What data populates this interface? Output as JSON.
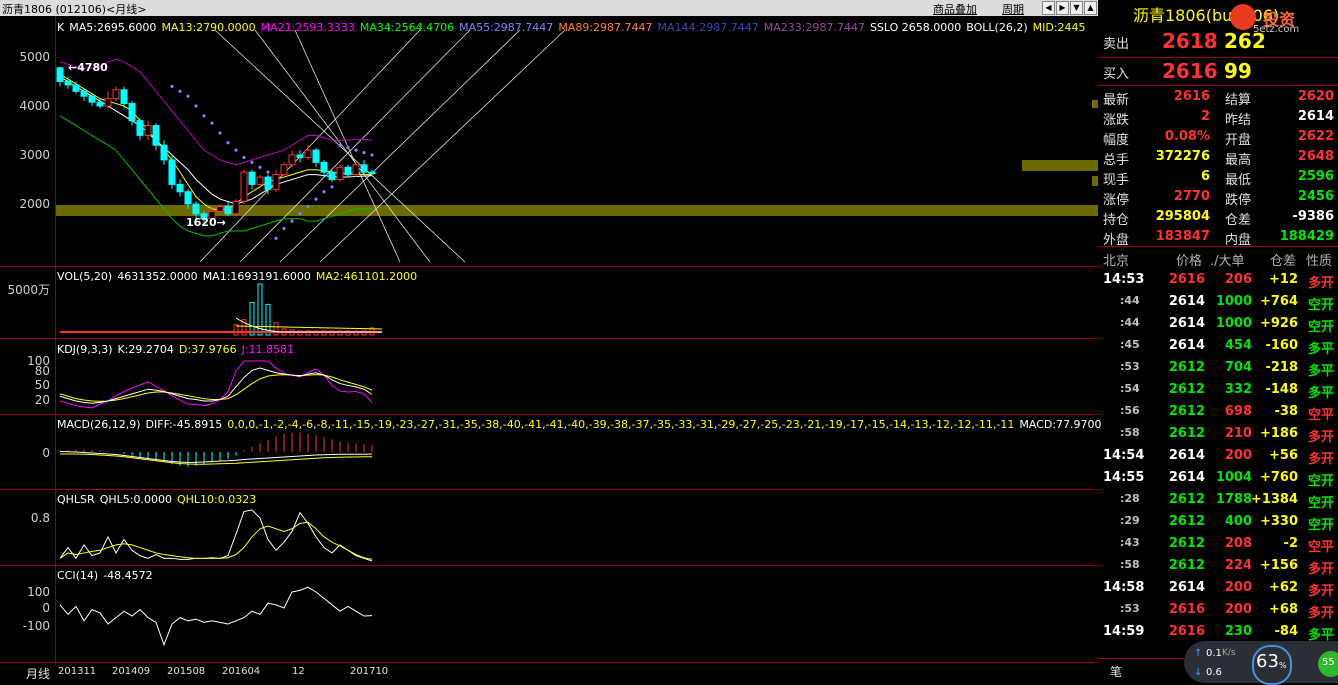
{
  "window": {
    "title": "沥青1806 (012106)<月线>",
    "btn_overlay": "商品叠加",
    "btn_period": "周期"
  },
  "colors": {
    "up": "#ff3232",
    "down": "#00ffff",
    "grid": "#8b0000",
    "green": "#00e600",
    "yellow": "#ffff00",
    "magenta": "#ff00ff"
  },
  "main": {
    "labels": [
      {
        "t": "K",
        "c": "#ffffff"
      },
      {
        "t": "MA5:2695.6000",
        "c": "#ffffff"
      },
      {
        "t": "MA13:2790.0000",
        "c": "#ffff00"
      },
      {
        "t": "MA21:2593.3333",
        "c": "#ff00ff"
      },
      {
        "t": "MA34:2564.4706",
        "c": "#00ff00"
      },
      {
        "t": "MA55:2987.7447",
        "c": "#8080ff"
      },
      {
        "t": "MA89:2987.7447",
        "c": "#ff8040"
      },
      {
        "t": "MA144:2987.7447",
        "c": "#4040c0"
      },
      {
        "t": "MA233:2987.7447",
        "c": "#a040a0"
      },
      {
        "t": "SSLO 2658.0000",
        "c": "#ffffff"
      },
      {
        "t": "BOLL(26,2)",
        "c": "#ffffff"
      },
      {
        "t": "MID:2445",
        "c": "#ffff00"
      }
    ],
    "yaxis": [
      "5000",
      "4000",
      "3000",
      "2000"
    ],
    "high_mark": "4780",
    "low_mark": "1620",
    "candles": [
      [
        4780,
        4500,
        4800,
        4400
      ],
      [
        4500,
        4430,
        4600,
        4350
      ],
      [
        4430,
        4300,
        4500,
        4250
      ],
      [
        4300,
        4200,
        4350,
        4100
      ],
      [
        4200,
        4080,
        4250,
        4000
      ],
      [
        4080,
        4000,
        4150,
        3950
      ],
      [
        4000,
        4150,
        4300,
        3950
      ],
      [
        4150,
        4330,
        4400,
        4100
      ],
      [
        4330,
        4050,
        4400,
        3950
      ],
      [
        4050,
        3700,
        4100,
        3600
      ],
      [
        3700,
        3400,
        3750,
        3300
      ],
      [
        3400,
        3600,
        3700,
        3300
      ],
      [
        3600,
        3200,
        3650,
        3100
      ],
      [
        3200,
        2900,
        3300,
        2800
      ],
      [
        2900,
        2400,
        3000,
        2300
      ],
      [
        2400,
        2250,
        2500,
        2150
      ],
      [
        2250,
        2000,
        2300,
        1900
      ],
      [
        2000,
        1800,
        2050,
        1700
      ],
      [
        1800,
        1700,
        1850,
        1620
      ],
      [
        1700,
        1850,
        1950,
        1650
      ],
      [
        1850,
        1950,
        2000,
        1800
      ],
      [
        1950,
        1800,
        2050,
        1750
      ],
      [
        1800,
        2050,
        2100,
        1750
      ],
      [
        2050,
        2650,
        2700,
        2000
      ],
      [
        2650,
        2400,
        2700,
        2300
      ],
      [
        2400,
        2550,
        2600,
        2300
      ],
      [
        2550,
        2300,
        2600,
        2200
      ],
      [
        2300,
        2600,
        2700,
        2250
      ],
      [
        2600,
        2800,
        2850,
        2550
      ],
      [
        2800,
        3000,
        3100,
        2750
      ],
      [
        3000,
        2950,
        3100,
        2850
      ],
      [
        2950,
        3100,
        3200,
        2900
      ],
      [
        3100,
        2850,
        3150,
        2750
      ],
      [
        2850,
        2650,
        2900,
        2550
      ],
      [
        2650,
        2500,
        2700,
        2450
      ],
      [
        2500,
        2750,
        2800,
        2450
      ],
      [
        2750,
        2600,
        2800,
        2550
      ],
      [
        2600,
        2800,
        2850,
        2550
      ],
      [
        2800,
        2650,
        2900,
        2600
      ],
      [
        2650,
        2618,
        2700,
        2596
      ]
    ],
    "boll_upper": [
      4900,
      4850,
      4800,
      4780,
      4770,
      4800,
      4900,
      4950,
      4900,
      4800,
      4700,
      4500,
      4300,
      4100,
      3900,
      3700,
      3500,
      3300,
      3100,
      3000,
      2900,
      2850,
      2800,
      2850,
      2900,
      2950,
      3000,
      3050,
      3100,
      3200,
      3300,
      3400,
      3400,
      3350,
      3300,
      3300,
      3300,
      3320,
      3320,
      3300
    ],
    "boll_lower": [
      3800,
      3700,
      3600,
      3500,
      3400,
      3300,
      3200,
      3100,
      2900,
      2700,
      2500,
      2300,
      2100,
      1900,
      1700,
      1550,
      1450,
      1400,
      1350,
      1350,
      1400,
      1450,
      1450,
      1450,
      1500,
      1550,
      1600,
      1650,
      1700,
      1700,
      1700,
      1650,
      1650,
      1700,
      1750,
      1800,
      1850,
      1900,
      1900,
      1900
    ],
    "ma_yellow": [
      4650,
      4550,
      4450,
      4350,
      4250,
      4150,
      4100,
      4050,
      4000,
      3900,
      3700,
      3500,
      3300,
      3100,
      2900,
      2650,
      2400,
      2150,
      2000,
      1900,
      1880,
      1900,
      2000,
      2150,
      2250,
      2350,
      2450,
      2500,
      2550,
      2600,
      2650,
      2700,
      2700,
      2680,
      2650,
      2630,
      2620,
      2610,
      2600,
      2600
    ],
    "ma_white": [
      4600,
      4500,
      4400,
      4300,
      4200,
      4100,
      4000,
      3900,
      3800,
      3700,
      3600,
      3450,
      3300,
      3150,
      3000,
      2850,
      2700,
      2500,
      2350,
      2200,
      2100,
      2050,
      2000,
      2050,
      2100,
      2200,
      2300,
      2400,
      2450,
      2500,
      2550,
      2600,
      2600,
      2580,
      2560,
      2550,
      2550,
      2560,
      2570,
      2580
    ],
    "sar": [
      null,
      null,
      null,
      null,
      null,
      null,
      null,
      null,
      null,
      null,
      null,
      null,
      null,
      null,
      4400,
      4300,
      4200,
      4000,
      3800,
      3650,
      3450,
      3250,
      3100,
      2950,
      2850,
      2750,
      2650,
      1300,
      1500,
      1650,
      1800,
      1950,
      2100,
      2250,
      2350,
      3200,
      3150,
      3100,
      3050,
      3000
    ]
  },
  "vol": {
    "title": "VOL(5,20)",
    "v": "4631352.0000",
    "ma1": "MA1:1693191.6000",
    "ma2": "MA2:461101.2000",
    "yaxis": "5000万",
    "bars": [
      0,
      0,
      0,
      0,
      0,
      0,
      0,
      0,
      0,
      0,
      0,
      0,
      0,
      0,
      0,
      0,
      0,
      0,
      0,
      0,
      0,
      0,
      1000,
      1500,
      3200,
      5000,
      3000,
      1200,
      600,
      500,
      400,
      400,
      400,
      400,
      400,
      400,
      400,
      400,
      400,
      700
    ]
  },
  "kdj": {
    "title": "KDJ(9,3,3)",
    "k": "K:29.2704",
    "d": "D:37.9766",
    "j": "J:11.8581",
    "yaxis": [
      "100",
      "80",
      "50",
      "20"
    ],
    "K": [
      25,
      20,
      15,
      12,
      10,
      12,
      15,
      20,
      25,
      30,
      35,
      40,
      38,
      35,
      30,
      25,
      20,
      18,
      15,
      15,
      18,
      25,
      45,
      65,
      80,
      85,
      80,
      75,
      72,
      70,
      68,
      72,
      75,
      70,
      60,
      52,
      48,
      45,
      40,
      29
    ],
    "D": [
      30,
      25,
      20,
      17,
      15,
      14,
      15,
      17,
      20,
      24,
      28,
      32,
      34,
      34,
      32,
      29,
      26,
      23,
      20,
      18,
      18,
      20,
      28,
      40,
      52,
      62,
      68,
      70,
      71,
      70,
      69,
      70,
      71,
      70,
      66,
      60,
      55,
      50,
      45,
      38
    ],
    "J": [
      15,
      10,
      5,
      2,
      0,
      8,
      15,
      26,
      35,
      42,
      49,
      56,
      46,
      37,
      26,
      17,
      8,
      8,
      5,
      9,
      18,
      35,
      79,
      100,
      100,
      100,
      100,
      85,
      74,
      70,
      66,
      76,
      83,
      70,
      48,
      36,
      34,
      35,
      30,
      12
    ]
  },
  "macd": {
    "title": "MACD(26,12,9)",
    "diff": "DIFF:-45.8915",
    "dea": [
      0,
      0,
      0,
      -1,
      -2,
      -4,
      -6,
      -8,
      -11,
      -15,
      -19,
      -23,
      -27,
      -31,
      -35,
      -38,
      -40,
      -41,
      -41,
      -40,
      -39,
      -38,
      -37,
      -35,
      -33,
      -31,
      -29,
      -27,
      -25,
      -23,
      -21,
      -19,
      -17,
      -15,
      -14,
      -13,
      -12,
      -12,
      -11,
      -11
    ],
    "macd": "MACD:77.9700",
    "yaxis": "0",
    "hist": [
      5,
      6,
      7,
      7,
      6,
      5,
      3,
      0,
      -5,
      -10,
      -15,
      -20,
      -25,
      -30,
      -35,
      -40,
      -42,
      -40,
      -35,
      -30,
      -25,
      -20,
      -10,
      5,
      15,
      25,
      35,
      45,
      52,
      55,
      56,
      52,
      48,
      42,
      36,
      30,
      26,
      24,
      22,
      20
    ],
    "dif": [
      2,
      1,
      0,
      -2,
      -4,
      -6,
      -8,
      -10,
      -14,
      -18,
      -22,
      -26,
      -30,
      -34,
      -38,
      -40,
      -42,
      -41,
      -40,
      -38,
      -36,
      -35,
      -33,
      -30,
      -28,
      -26,
      -24,
      -22,
      -20,
      -18,
      -16,
      -14,
      -12,
      -11,
      -10,
      -9,
      -9,
      -9,
      -9,
      -8
    ]
  },
  "qhlsr": {
    "title": "QHLSR",
    "q5": "QHL5:0.0000",
    "q10": "QHL10:0.0323",
    "yaxis": "0.8",
    "w": [
      0.05,
      0.25,
      0.05,
      0.3,
      0.1,
      0.15,
      0.45,
      0.15,
      0.4,
      0.2,
      0.1,
      0.05,
      0.12,
      0.05,
      0.05,
      0.03,
      0.03,
      0.05,
      0.05,
      0.06,
      0.05,
      0.1,
      0.5,
      0.92,
      0.95,
      0.8,
      0.4,
      0.2,
      0.35,
      0.55,
      0.9,
      0.7,
      0.45,
      0.25,
      0.15,
      0.3,
      0.2,
      0.1,
      0.05,
      0
    ],
    "y": [
      0.05,
      0.15,
      0.12,
      0.15,
      0.18,
      0.2,
      0.25,
      0.3,
      0.32,
      0.3,
      0.25,
      0.2,
      0.15,
      0.12,
      0.1,
      0.08,
      0.06,
      0.05,
      0.05,
      0.05,
      0.05,
      0.06,
      0.12,
      0.25,
      0.45,
      0.6,
      0.65,
      0.6,
      0.55,
      0.6,
      0.7,
      0.72,
      0.6,
      0.45,
      0.35,
      0.28,
      0.2,
      0.12,
      0.06,
      0.03
    ]
  },
  "cci": {
    "title": "CCI(14)",
    "val": "-48.4572",
    "yaxis": [
      "100",
      "0",
      "-100"
    ],
    "v": [
      20,
      -40,
      10,
      -80,
      -10,
      -30,
      -100,
      -60,
      -20,
      -50,
      -10,
      -60,
      -90,
      -230,
      -100,
      -60,
      -80,
      -70,
      -90,
      -80,
      -90,
      -100,
      -80,
      -60,
      -20,
      -40,
      30,
      20,
      0,
      100,
      110,
      130,
      100,
      60,
      20,
      -20,
      10,
      -20,
      -50,
      -48
    ]
  },
  "xaxis": {
    "label": "月线",
    "ticks": [
      "201311",
      "201409",
      "201508",
      "201604",
      "12",
      "201710"
    ]
  },
  "quote": {
    "title": "沥青1806(bu1806)",
    "brand": "投资",
    "brand_sub": "5etz.com",
    "ask_label": "卖出",
    "ask_price": "2618",
    "ask_vol": "262",
    "bid_label": "买入",
    "bid_price": "2616",
    "bid_vol": "99",
    "rows": [
      {
        "k": "最新",
        "v": "2616",
        "vc": "red",
        "k2": "结算",
        "v2": "2620",
        "v2c": "red"
      },
      {
        "k": "涨跌",
        "v": "2",
        "vc": "red",
        "k2": "昨结",
        "v2": "2614",
        "v2c": "white"
      },
      {
        "k": "幅度",
        "v": "0.08%",
        "vc": "red",
        "k2": "开盘",
        "v2": "2622",
        "v2c": "red"
      },
      {
        "k": "总手",
        "v": "372276",
        "vc": "yellow",
        "k2": "最高",
        "v2": "2648",
        "v2c": "red"
      },
      {
        "k": "现手",
        "v": "6",
        "vc": "yellow",
        "k2": "最低",
        "v2": "2596",
        "v2c": "green"
      },
      {
        "k": "涨停",
        "v": "2770",
        "vc": "red",
        "k2": "跌停",
        "v2": "2456",
        "v2c": "green"
      },
      {
        "k": "持仓",
        "v": "295804",
        "vc": "yellow",
        "k2": "仓差",
        "v2": "-9386",
        "v2c": "white"
      },
      {
        "k": "外盘",
        "v": "183847",
        "vc": "red",
        "k2": "内盘",
        "v2": "188429",
        "v2c": "green"
      }
    ],
    "tick_headers": [
      "北京",
      "价格",
      "./大单",
      "仓差",
      "性质"
    ],
    "ticks": [
      {
        "t": "14:53",
        "p": "2616",
        "pc": "red",
        "v": "206",
        "vc": "red",
        "d": "+12",
        "n": "多开",
        "nc": "red"
      },
      {
        "t": ":44",
        "p": "2614",
        "pc": "white",
        "v": "1000",
        "vc": "green",
        "d": "+764",
        "n": "空开",
        "nc": "green"
      },
      {
        "t": ":44",
        "p": "2614",
        "pc": "white",
        "v": "1000",
        "vc": "green",
        "d": "+926",
        "n": "空开",
        "nc": "green"
      },
      {
        "t": ":45",
        "p": "2614",
        "pc": "white",
        "v": "454",
        "vc": "green",
        "d": "-160",
        "n": "多平",
        "nc": "green"
      },
      {
        "t": ":53",
        "p": "2612",
        "pc": "green",
        "v": "704",
        "vc": "green",
        "d": "-218",
        "n": "多平",
        "nc": "green"
      },
      {
        "t": ":54",
        "p": "2612",
        "pc": "green",
        "v": "332",
        "vc": "green",
        "d": "-148",
        "n": "多平",
        "nc": "green"
      },
      {
        "t": ":56",
        "p": "2612",
        "pc": "green",
        "v": "698",
        "vc": "red",
        "d": "-38",
        "n": "空平",
        "nc": "red"
      },
      {
        "t": ":58",
        "p": "2612",
        "pc": "green",
        "v": "210",
        "vc": "red",
        "d": "+186",
        "n": "多开",
        "nc": "red"
      },
      {
        "t": "14:54",
        "p": "2614",
        "pc": "white",
        "v": "200",
        "vc": "red",
        "d": "+56",
        "n": "多开",
        "nc": "red"
      },
      {
        "t": "14:55",
        "p": "2614",
        "pc": "white",
        "v": "1004",
        "vc": "green",
        "d": "+760",
        "n": "空开",
        "nc": "green"
      },
      {
        "t": ":28",
        "p": "2612",
        "pc": "green",
        "v": "1788",
        "vc": "green",
        "d": "+1384",
        "n": "空开",
        "nc": "green"
      },
      {
        "t": ":29",
        "p": "2612",
        "pc": "green",
        "v": "400",
        "vc": "green",
        "d": "+330",
        "n": "空开",
        "nc": "green"
      },
      {
        "t": ":43",
        "p": "2612",
        "pc": "green",
        "v": "208",
        "vc": "red",
        "d": "-2",
        "n": "空平",
        "nc": "red"
      },
      {
        "t": ":58",
        "p": "2612",
        "pc": "green",
        "v": "224",
        "vc": "red",
        "d": "+156",
        "n": "多开",
        "nc": "red"
      },
      {
        "t": "14:58",
        "p": "2614",
        "pc": "white",
        "v": "200",
        "vc": "red",
        "d": "+62",
        "n": "多开",
        "nc": "red"
      },
      {
        "t": ":53",
        "p": "2616",
        "pc": "red",
        "v": "200",
        "vc": "red",
        "d": "+68",
        "n": "多开",
        "nc": "red"
      },
      {
        "t": "14:59",
        "p": "2616",
        "pc": "red",
        "v": "230",
        "vc": "green",
        "d": "-84",
        "n": "多平",
        "nc": "green"
      }
    ],
    "footer_tab": "笔",
    "net_up": "0.1",
    "net_up_unit": "K/s",
    "net_down": "0.6",
    "gauge": "63",
    "gauge_unit": "%",
    "gauge2": "55"
  }
}
